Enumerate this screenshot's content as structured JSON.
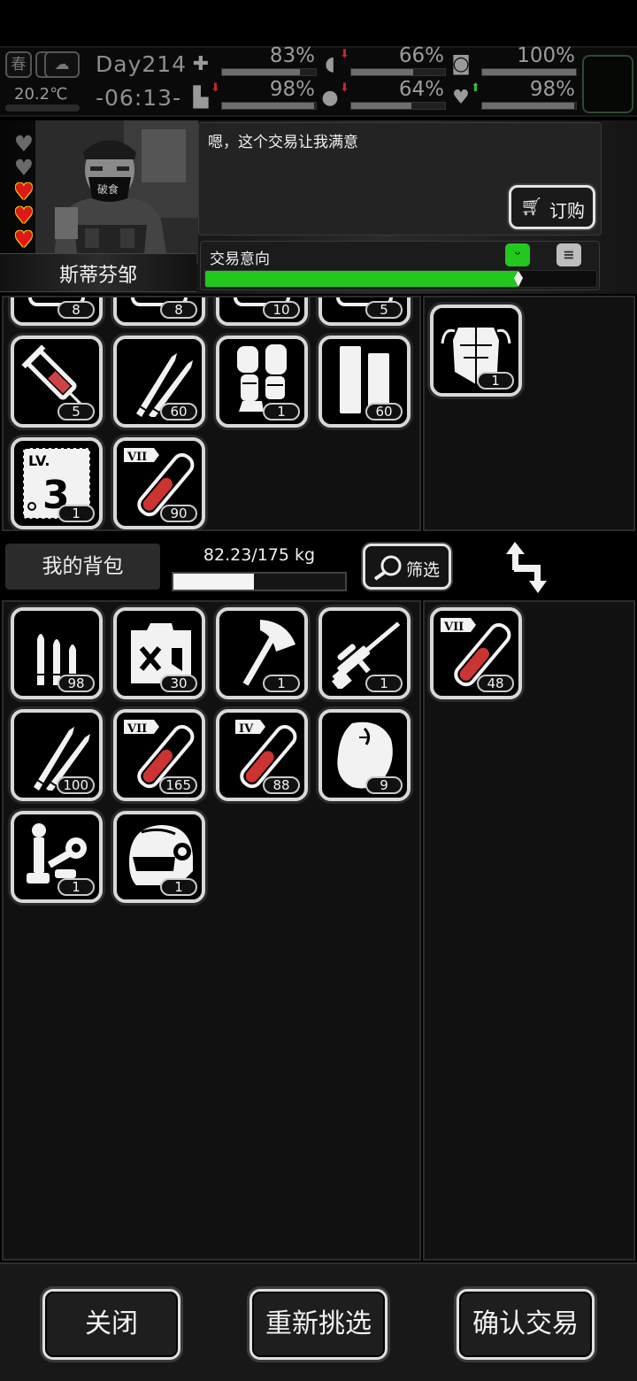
{
  "status": {
    "season": "春",
    "temperature": "20.2℃",
    "day": "Day214",
    "time": "-06:13-",
    "stats": [
      {
        "icon": "medkit-icon",
        "glyph": "✚",
        "value": "83%",
        "level": 0.83,
        "trend": ""
      },
      {
        "icon": "stomach-icon",
        "glyph": "◖",
        "value": "66%",
        "level": 0.66,
        "trend": "down"
      },
      {
        "icon": "sleep-icon",
        "glyph": "◙",
        "value": "100%",
        "level": 1.0,
        "trend": ""
      },
      {
        "icon": "stamina-icon",
        "glyph": "▙",
        "value": "98%",
        "level": 0.98,
        "trend": "down"
      },
      {
        "icon": "water-drop-icon",
        "glyph": "●",
        "value": "64%",
        "level": 0.64,
        "trend": "down"
      },
      {
        "icon": "heart-icon",
        "glyph": "♥",
        "value": "98%",
        "level": 0.98,
        "trend": "up"
      }
    ]
  },
  "trader": {
    "name": "斯蒂芬邹",
    "dialog": "嗯，这个交易让我满意",
    "order_label": "订购",
    "intent_label": "交易意向",
    "intent_level": 0.8,
    "hearts": [
      "empty",
      "empty",
      "full",
      "full",
      "full"
    ]
  },
  "trader_items": [
    {
      "icon": "item-icon",
      "count": "8"
    },
    {
      "icon": "item-icon",
      "count": "8"
    },
    {
      "icon": "item-icon",
      "count": "10"
    },
    {
      "icon": "item-icon",
      "count": "5"
    },
    {
      "icon": "syringe-icon",
      "count": "5"
    },
    {
      "icon": "rifle-bullets-icon",
      "count": "60"
    },
    {
      "icon": "leg-armor-icon",
      "count": "1"
    },
    {
      "icon": "battery-cells-icon",
      "count": "60"
    },
    {
      "icon": "skill-book-icon",
      "count": "1"
    },
    {
      "icon": "test-tube-vii-icon",
      "count": "90"
    }
  ],
  "trader_offer": [
    {
      "icon": "body-armor-icon",
      "count": "1"
    }
  ],
  "backpack": {
    "title": "我的背包",
    "weight": "82.23/175 kg",
    "weight_level": 0.47,
    "filter_label": "筛选"
  },
  "backpack_items": [
    {
      "icon": "pistol-ammo-icon",
      "count": "98"
    },
    {
      "icon": "fuel-canister-icon",
      "count": "30"
    },
    {
      "icon": "axe-icon",
      "count": "1"
    },
    {
      "icon": "sniper-rifle-icon",
      "count": "1"
    },
    {
      "icon": "rifle-bullets-icon",
      "count": "100"
    },
    {
      "icon": "test-tube-vii-icon",
      "count": "165"
    },
    {
      "icon": "test-tube-iv-icon",
      "count": "88"
    },
    {
      "icon": "raw-meat-icon",
      "count": "9"
    },
    {
      "icon": "mechanical-parts-icon",
      "count": "1"
    },
    {
      "icon": "combat-helmet-icon",
      "count": "1"
    }
  ],
  "player_offer": [
    {
      "icon": "test-tube-vii-icon",
      "count": "48"
    }
  ],
  "footer": {
    "close_label": "关闭",
    "reselect_label": "重新挑选",
    "confirm_label": "确认交易"
  }
}
